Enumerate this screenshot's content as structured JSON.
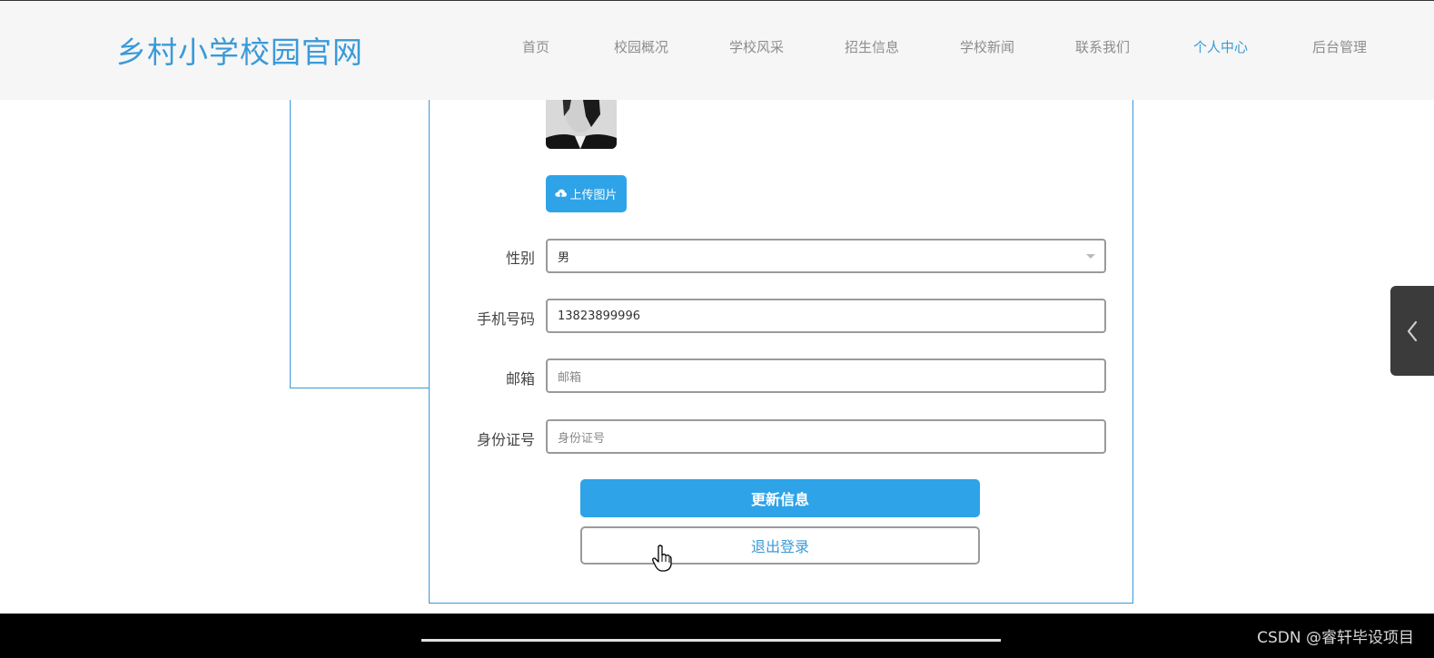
{
  "header": {
    "site_title": "乡村小学校园官网",
    "nav": [
      {
        "label": "首页"
      },
      {
        "label": "校园概况"
      },
      {
        "label": "学校风采"
      },
      {
        "label": "招生信息"
      },
      {
        "label": "学校新闻"
      },
      {
        "label": "联系我们"
      },
      {
        "label": "个人中心",
        "active": true
      },
      {
        "label": "后台管理"
      }
    ]
  },
  "form": {
    "upload_label": "上传图片",
    "gender": {
      "label": "性别",
      "value": "男"
    },
    "phone": {
      "label": "手机号码",
      "value": "13823899996"
    },
    "email": {
      "label": "邮箱",
      "value": "",
      "placeholder": "邮箱"
    },
    "id_card": {
      "label": "身份证号",
      "value": "",
      "placeholder": "身份证号"
    },
    "update_label": "更新信息",
    "logout_label": "退出登录"
  },
  "footer": {
    "watermark": "CSDN @睿轩毕设项目"
  },
  "colors": {
    "accent": "#3a9ad9",
    "button": "#2ea3e8"
  },
  "icons": {
    "upload": "cloud-upload-icon",
    "side_tab": "chevron-left-icon",
    "dropdown": "caret-down-icon"
  }
}
